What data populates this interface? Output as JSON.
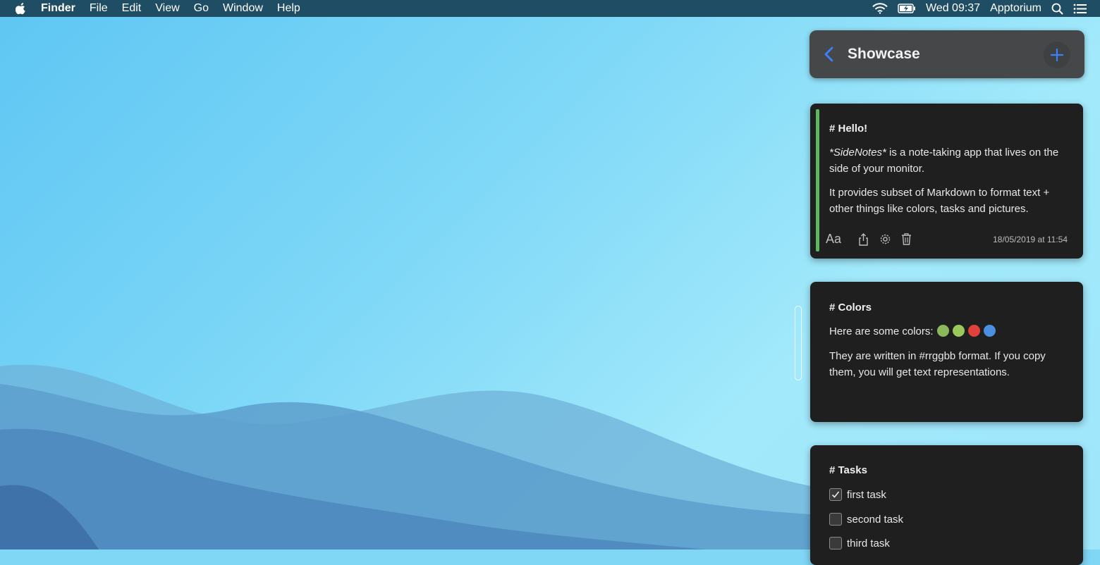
{
  "menubar": {
    "apple_icon": "apple-logo-icon",
    "app_name": "Finder",
    "menus": [
      "File",
      "Edit",
      "View",
      "Go",
      "Window",
      "Help"
    ],
    "status": {
      "wifi_icon": "wifi-icon",
      "battery_icon": "battery-charging-icon",
      "datetime": "Wed 09:37",
      "user": "Apptorium",
      "search_icon": "spotlight-search-icon",
      "list_icon": "notification-center-icon"
    }
  },
  "panel": {
    "title": "Showcase",
    "back_icon": "chevron-left-icon",
    "add_icon": "plus-icon",
    "accent_color": "#3b82f6"
  },
  "notes": [
    {
      "heading": "# Hello!",
      "paragraph1_prefix": "*SideNotes*",
      "paragraph1_rest": " is a note-taking app that lives on the side of your monitor.",
      "paragraph2": "It provides subset of Markdown to format text + other things like colors, tasks and pictures.",
      "accent_color": "#5cb85c",
      "toolbar": [
        "font-icon",
        "share-icon",
        "gear-icon",
        "trash-icon"
      ],
      "font_label": "Aa",
      "date": "18/05/2019 at 11:54"
    },
    {
      "heading": "# Colors",
      "paragraph1": "Here are some colors:",
      "swatches": [
        "#8bb85a",
        "#9bc85a",
        "#e0413a",
        "#4a90e2"
      ],
      "paragraph2": "They are written in #rrggbb format. If you copy them, you will get text representations."
    },
    {
      "heading": "# Tasks",
      "tasks": [
        {
          "label": "first task",
          "checked": true
        },
        {
          "label": "second task",
          "checked": false
        },
        {
          "label": "third task",
          "checked": false
        }
      ]
    }
  ]
}
